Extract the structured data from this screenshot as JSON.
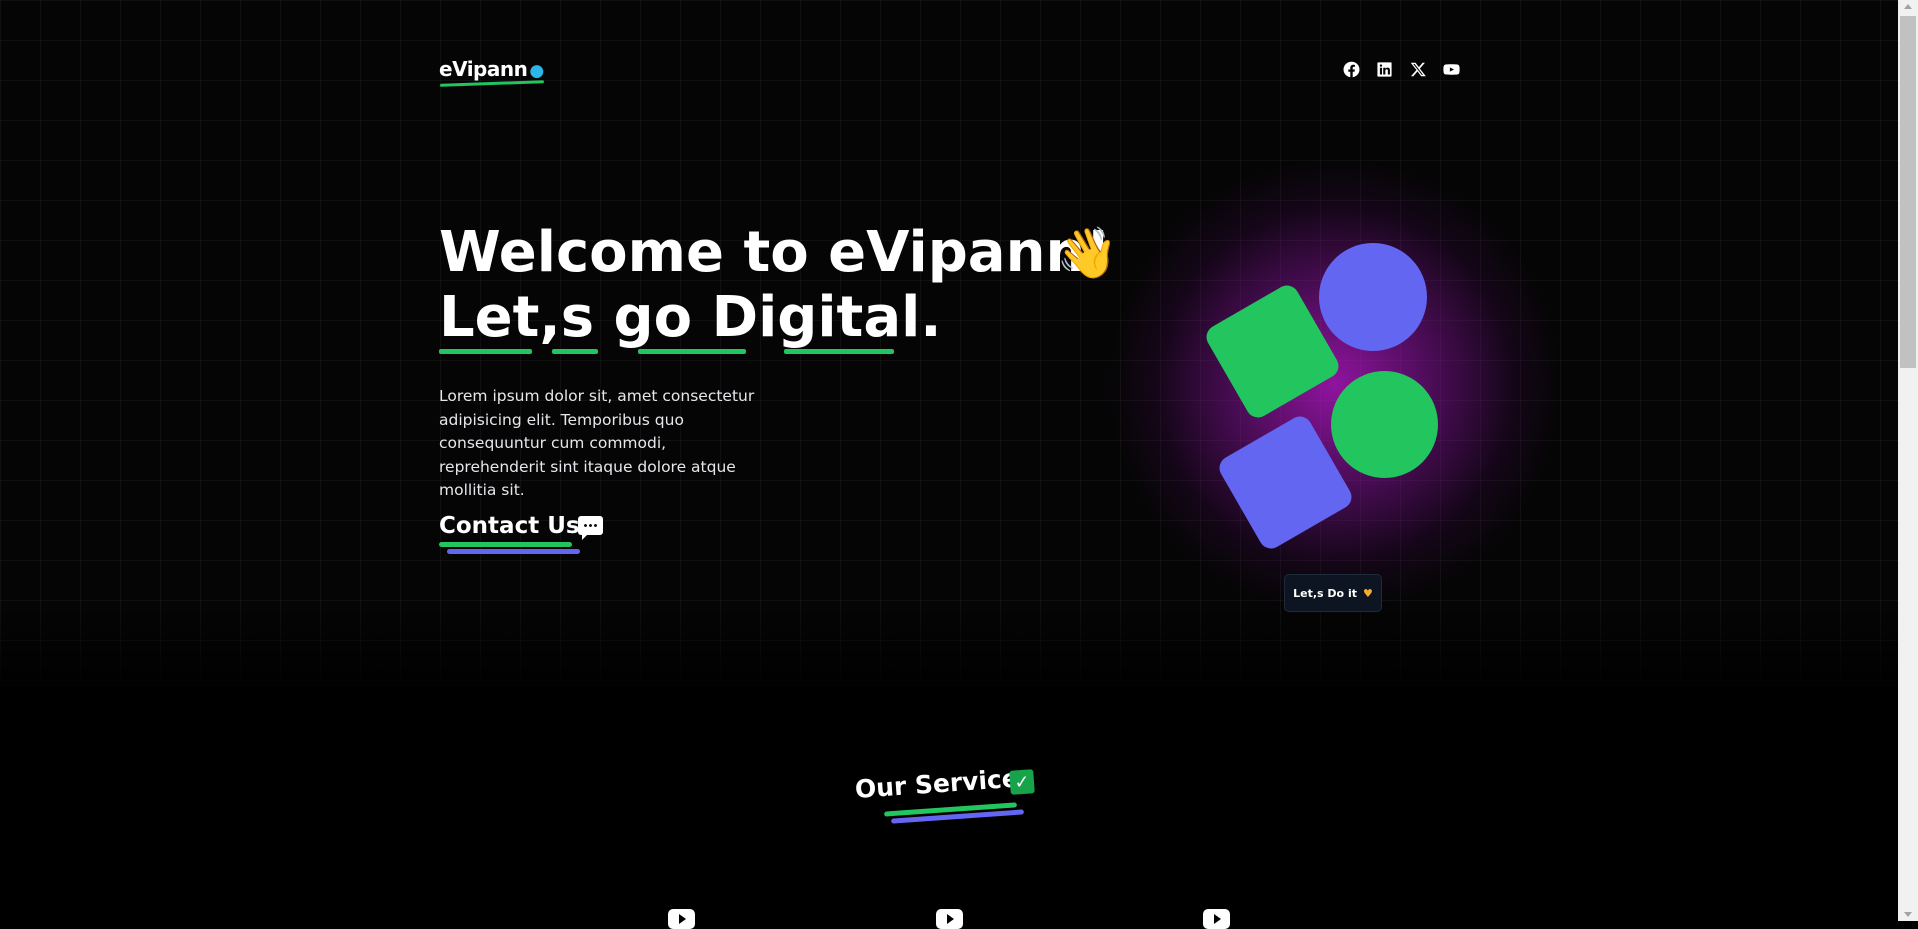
{
  "header": {
    "logo_text": "eVipann",
    "logo_icon": "globe-icon",
    "social": [
      {
        "name": "facebook-icon"
      },
      {
        "name": "linkedin-icon"
      },
      {
        "name": "x-icon"
      },
      {
        "name": "youtube-icon"
      }
    ]
  },
  "hero": {
    "title_line1": "Welcome to eVipann!",
    "wave_emoji": "👋",
    "title_line2": "Let,s go Digital.",
    "description": "Lorem ipsum dolor sit, amet consectetur adipisicing elit. Temporibus quo consequuntur cum commodi, reprehenderit sint itaque dolore atque mollitia sit.",
    "contact_label": "Contact Us",
    "contact_icon": "speech-bubble-icon",
    "cta_label": "Let,s Do it",
    "cta_icon": "heart-icon"
  },
  "services": {
    "title": "Our Services",
    "title_icon": "check-mark-icon",
    "item_icons": [
      "play-icon",
      "play-icon",
      "play-icon"
    ]
  },
  "colors": {
    "accent_green": "#22c55e",
    "accent_indigo": "#6366f1",
    "glow_purple": "#be19d2",
    "background": "#000000"
  }
}
